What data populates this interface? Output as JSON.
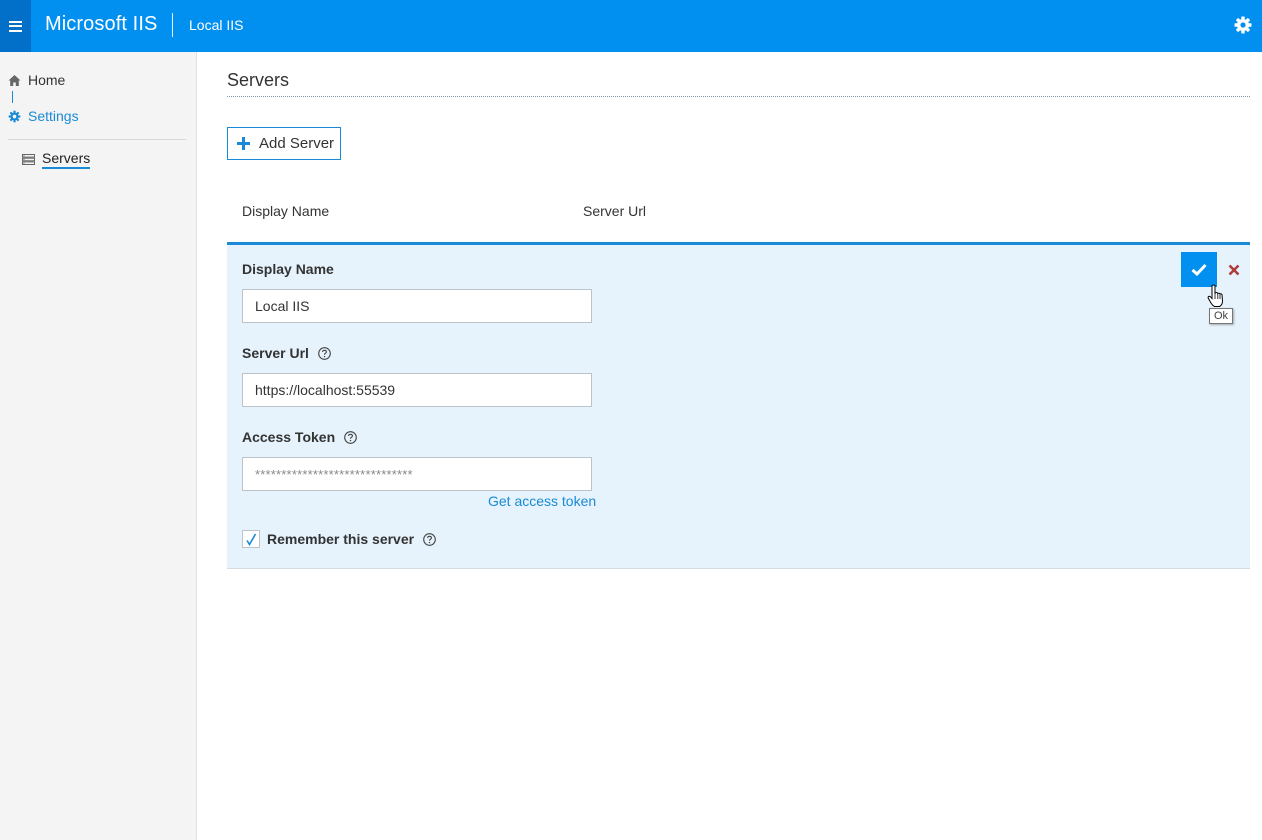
{
  "header": {
    "brand": "Microsoft IIS",
    "server_name": "Local IIS",
    "menu_icon": "hamburger-menu-icon",
    "settings_icon": "gear-icon"
  },
  "sidebar": {
    "items": [
      {
        "label": "Home",
        "icon": "home-icon",
        "active": false
      },
      {
        "label": "Settings",
        "icon": "gear-icon",
        "active": true
      }
    ],
    "subitems": [
      {
        "label": "Servers",
        "icon": "server-list-icon",
        "selected": true
      }
    ]
  },
  "main": {
    "title": "Servers",
    "add_button": {
      "label": "Add Server",
      "icon": "plus-icon"
    },
    "columns": [
      "Display Name",
      "Server Url"
    ],
    "edit_form": {
      "display_name": {
        "label": "Display Name",
        "value": "Local IIS"
      },
      "server_url": {
        "label": "Server Url",
        "value": "https://localhost:55539",
        "help_icon": "help-circle-icon"
      },
      "access_token": {
        "label": "Access Token",
        "value": "******************************",
        "help_icon": "help-circle-icon",
        "link": "Get access token"
      },
      "remember": {
        "label": "Remember this server",
        "checked": true,
        "help_icon": "help-circle-icon"
      },
      "ok_button": {
        "icon": "checkmark-icon",
        "tooltip": "Ok"
      },
      "cancel_button": {
        "icon": "close-icon"
      }
    }
  },
  "colors": {
    "accent": "#0290f0",
    "accent_dark": "#0270c8",
    "link": "#1a8ad6",
    "panel_bg": "#e6f3fc",
    "cancel_red": "#b03a3a"
  }
}
